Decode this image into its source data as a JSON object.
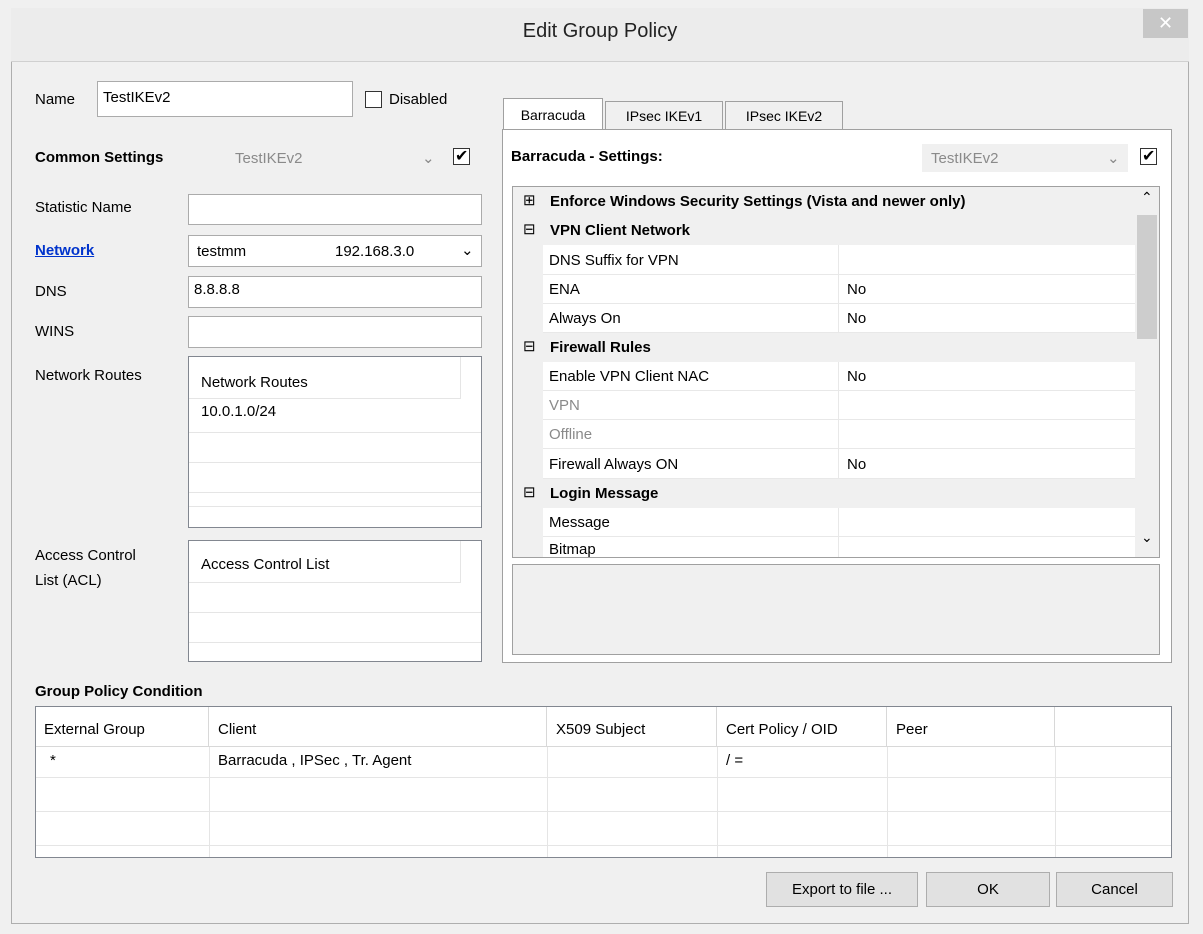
{
  "window": {
    "title": "Edit Group Policy",
    "close_glyph": "✕"
  },
  "name_field": {
    "label": "Name",
    "value": "TestIKEv2",
    "disabled_label": "Disabled"
  },
  "common": {
    "label": "Common Settings",
    "combo_value": "TestIKEv2",
    "checked": true
  },
  "fields": {
    "statistic_name_label": "Statistic Name",
    "statistic_name_value": "",
    "network_label": "Network",
    "network_name": "testmm",
    "network_ip": "192.168.3.0",
    "dns_label": "DNS",
    "dns_value": "8.8.8.8",
    "wins_label": "WINS",
    "wins_value": "",
    "routes_label": "Network Routes",
    "routes_header": "Network Routes",
    "routes": [
      "10.0.1.0/24"
    ],
    "acl_label_1": "Access Control",
    "acl_label_2": "List (ACL)",
    "acl_header": "Access Control List"
  },
  "tabs": [
    "Barracuda",
    "IPsec IKEv1",
    "IPsec IKEv2"
  ],
  "settings": {
    "label": "Barracuda - Settings:",
    "combo_value": "TestIKEv2",
    "checked": true,
    "categories": [
      {
        "toggle": "⊞",
        "label": "Enforce Windows Security Settings (Vista and newer only)"
      },
      {
        "toggle": "⊟",
        "label": "VPN Client Network"
      },
      {
        "toggle": "⊟",
        "label": "Firewall Rules"
      },
      {
        "toggle": "⊟",
        "label": "Login Message"
      }
    ],
    "props": [
      {
        "name": "DNS Suffix for VPN",
        "value": ""
      },
      {
        "name": "ENA",
        "value": "No"
      },
      {
        "name": "Always On",
        "value": "No"
      },
      {
        "name": "Enable VPN Client NAC",
        "value": "No"
      },
      {
        "name": "VPN",
        "value": ""
      },
      {
        "name": "Offline",
        "value": ""
      },
      {
        "name": "Firewall Always ON",
        "value": "No"
      },
      {
        "name": "Message",
        "value": ""
      },
      {
        "name": "Bitmap",
        "value": ""
      }
    ]
  },
  "condition": {
    "label": "Group Policy Condition",
    "columns": [
      "External Group",
      "Client",
      "X509 Subject",
      "Cert Policy / OID",
      "Peer"
    ],
    "rows": [
      [
        "*",
        "Barracuda , IPSec , Tr. Agent",
        "",
        "/ =",
        ""
      ]
    ]
  },
  "buttons": {
    "export": "Export to file ...",
    "ok": "OK",
    "cancel": "Cancel"
  },
  "icons": {
    "close": "close-icon",
    "dropdown": "chevron-down-icon",
    "scroll_up": "chevron-up-icon",
    "scroll_down": "chevron-down-icon",
    "expand": "plus-box-icon",
    "collapse": "minus-box-icon"
  }
}
